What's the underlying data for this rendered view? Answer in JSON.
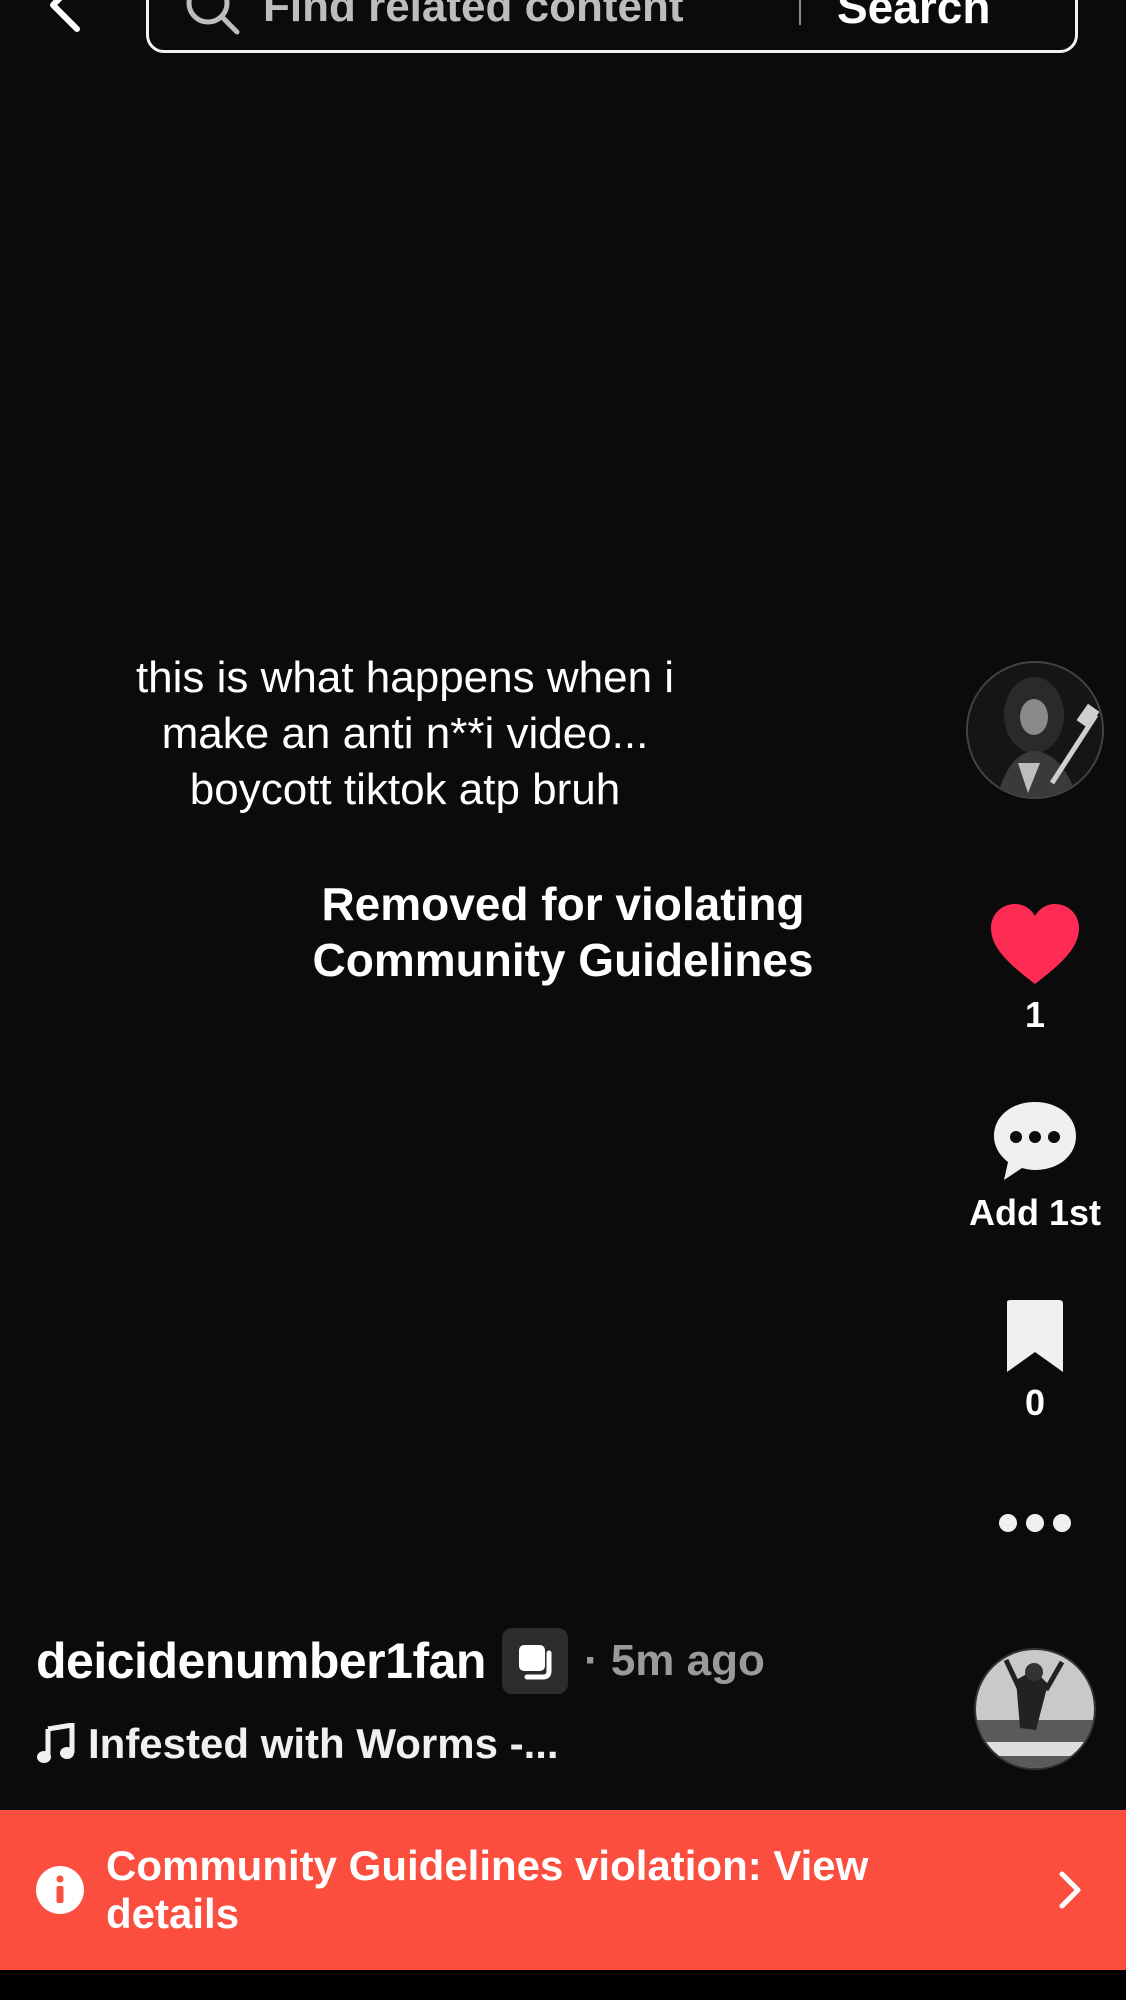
{
  "header": {
    "search_placeholder": "Find related content",
    "search_button": "Search"
  },
  "video": {
    "caption_lines": [
      "this is what happens when i",
      "make an anti n**i video...",
      "boycott tiktok atp bruh"
    ],
    "removed_notice_lines": [
      "Removed for violating",
      "Community Guidelines"
    ]
  },
  "actions": {
    "like_count": "1",
    "comment_label": "Add 1st",
    "bookmark_count": "0"
  },
  "post": {
    "username": "deicidenumber1fan",
    "time": "· 5m ago",
    "sound": "Infested with Worms -..."
  },
  "banner": {
    "text": "Community Guidelines violation: View details"
  },
  "colors": {
    "background": "#0b0b0c",
    "like_red": "#fe2c55",
    "banner_red": "#fb4e3f"
  }
}
